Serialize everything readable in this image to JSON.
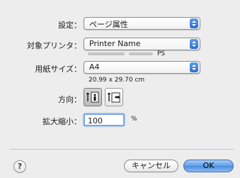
{
  "settings": {
    "label": "設定：",
    "value": "ページ属性"
  },
  "printer": {
    "label": "対象プリンタ：",
    "value": "Printer Name",
    "sub": "PS"
  },
  "paper": {
    "label": "用紙サイズ：",
    "value": "A4",
    "dimensions": "20.99 x 29.70 cm"
  },
  "orientation": {
    "label": "方向：",
    "options": [
      "portrait",
      "landscape"
    ],
    "selected": "portrait"
  },
  "scale": {
    "label": "拡大縮小：",
    "value": "100",
    "unit": "%"
  },
  "help": {
    "label": "?"
  },
  "buttons": {
    "cancel": "キャンセル",
    "ok": "OK"
  },
  "colors": {
    "accent": "#3b7fe0",
    "background": "#ededed"
  }
}
